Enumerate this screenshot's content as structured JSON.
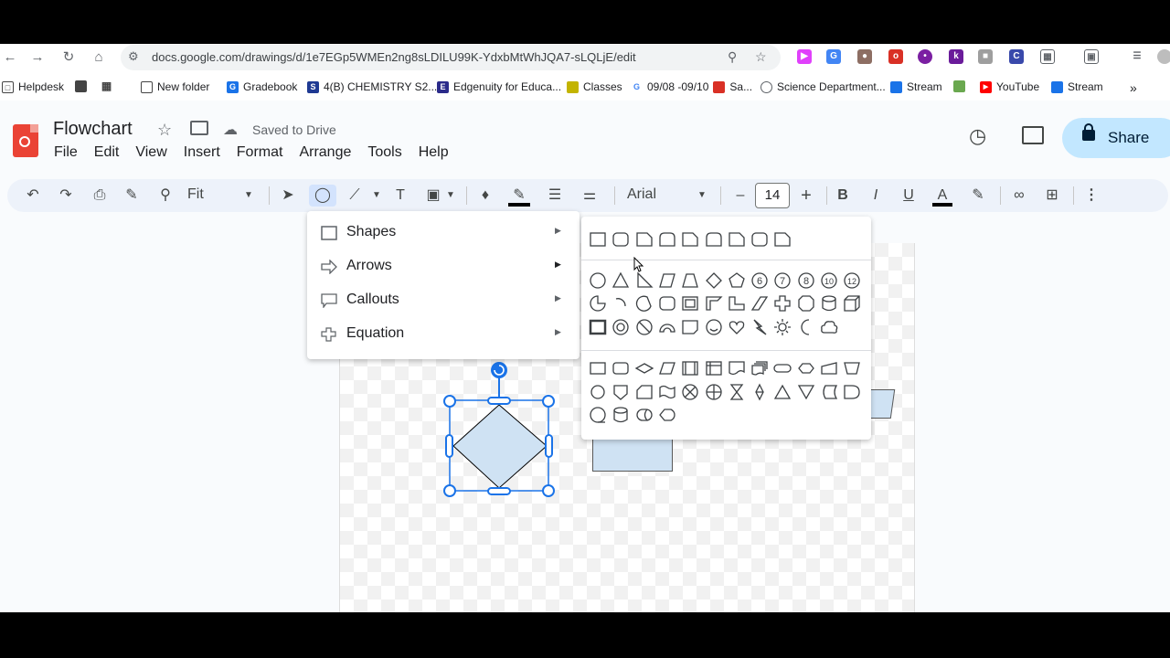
{
  "browser": {
    "url": "docs.google.com/drawings/d/1e7EGp5WMEn2ng8sLDILU99K-YdxbMtWhJQA7-sLQLjE/edit",
    "bookmarks": [
      {
        "label": "Helpdesk",
        "icon": "helpdesk-icon",
        "color": "#444"
      },
      {
        "label": "",
        "icon": "app-square-icon",
        "color": "#444"
      },
      {
        "label": "",
        "icon": "apps-grid-icon",
        "color": "#444"
      },
      {
        "label": "New folder",
        "icon": "folder-icon",
        "color": "#444"
      },
      {
        "label": "Gradebook",
        "icon": "gradebook-icon",
        "color": "#1a73e8"
      },
      {
        "label": "4(B) CHEMISTRY S2...",
        "icon": "sis-icon",
        "color": "#1f3a93"
      },
      {
        "label": "Edgenuity for Educa...",
        "icon": "edgenuity-icon",
        "color": "#2b2b8a"
      },
      {
        "label": "Classes",
        "icon": "classroom-icon",
        "color": "#c3b400"
      },
      {
        "label": "09/08 -09/10",
        "icon": "google-icon",
        "color": "#4285f4"
      },
      {
        "label": "Sa...",
        "icon": "bag-icon",
        "color": "#d93025"
      },
      {
        "label": "Science Department...",
        "icon": "science-icon",
        "color": "#5f6368"
      },
      {
        "label": "Stream",
        "icon": "stream-icon",
        "color": "#1a73e8"
      },
      {
        "label": "",
        "icon": "photo-icon",
        "color": "#6aa84f"
      },
      {
        "label": "YouTube",
        "icon": "youtube-icon",
        "color": "#ff0000"
      },
      {
        "label": "Stream",
        "icon": "stream-icon",
        "color": "#1a73e8"
      }
    ]
  },
  "header": {
    "title": "Flowchart",
    "saved_status": "Saved to Drive",
    "menus": [
      "File",
      "Edit",
      "View",
      "Insert",
      "Format",
      "Arrange",
      "Tools",
      "Help"
    ],
    "share_label": "Share"
  },
  "toolbar": {
    "zoom": "Fit",
    "font": "Arial",
    "font_size": "14"
  },
  "shape_menu": {
    "items": [
      {
        "label": "Shapes"
      },
      {
        "label": "Arrows"
      },
      {
        "label": "Callouts"
      },
      {
        "label": "Equation"
      }
    ]
  },
  "colors": {
    "accent": "#1a73e8",
    "shape_fill": "#cfe2f3",
    "share_bg": "#c2e7ff",
    "toolbar_bg": "#edf2fa"
  }
}
